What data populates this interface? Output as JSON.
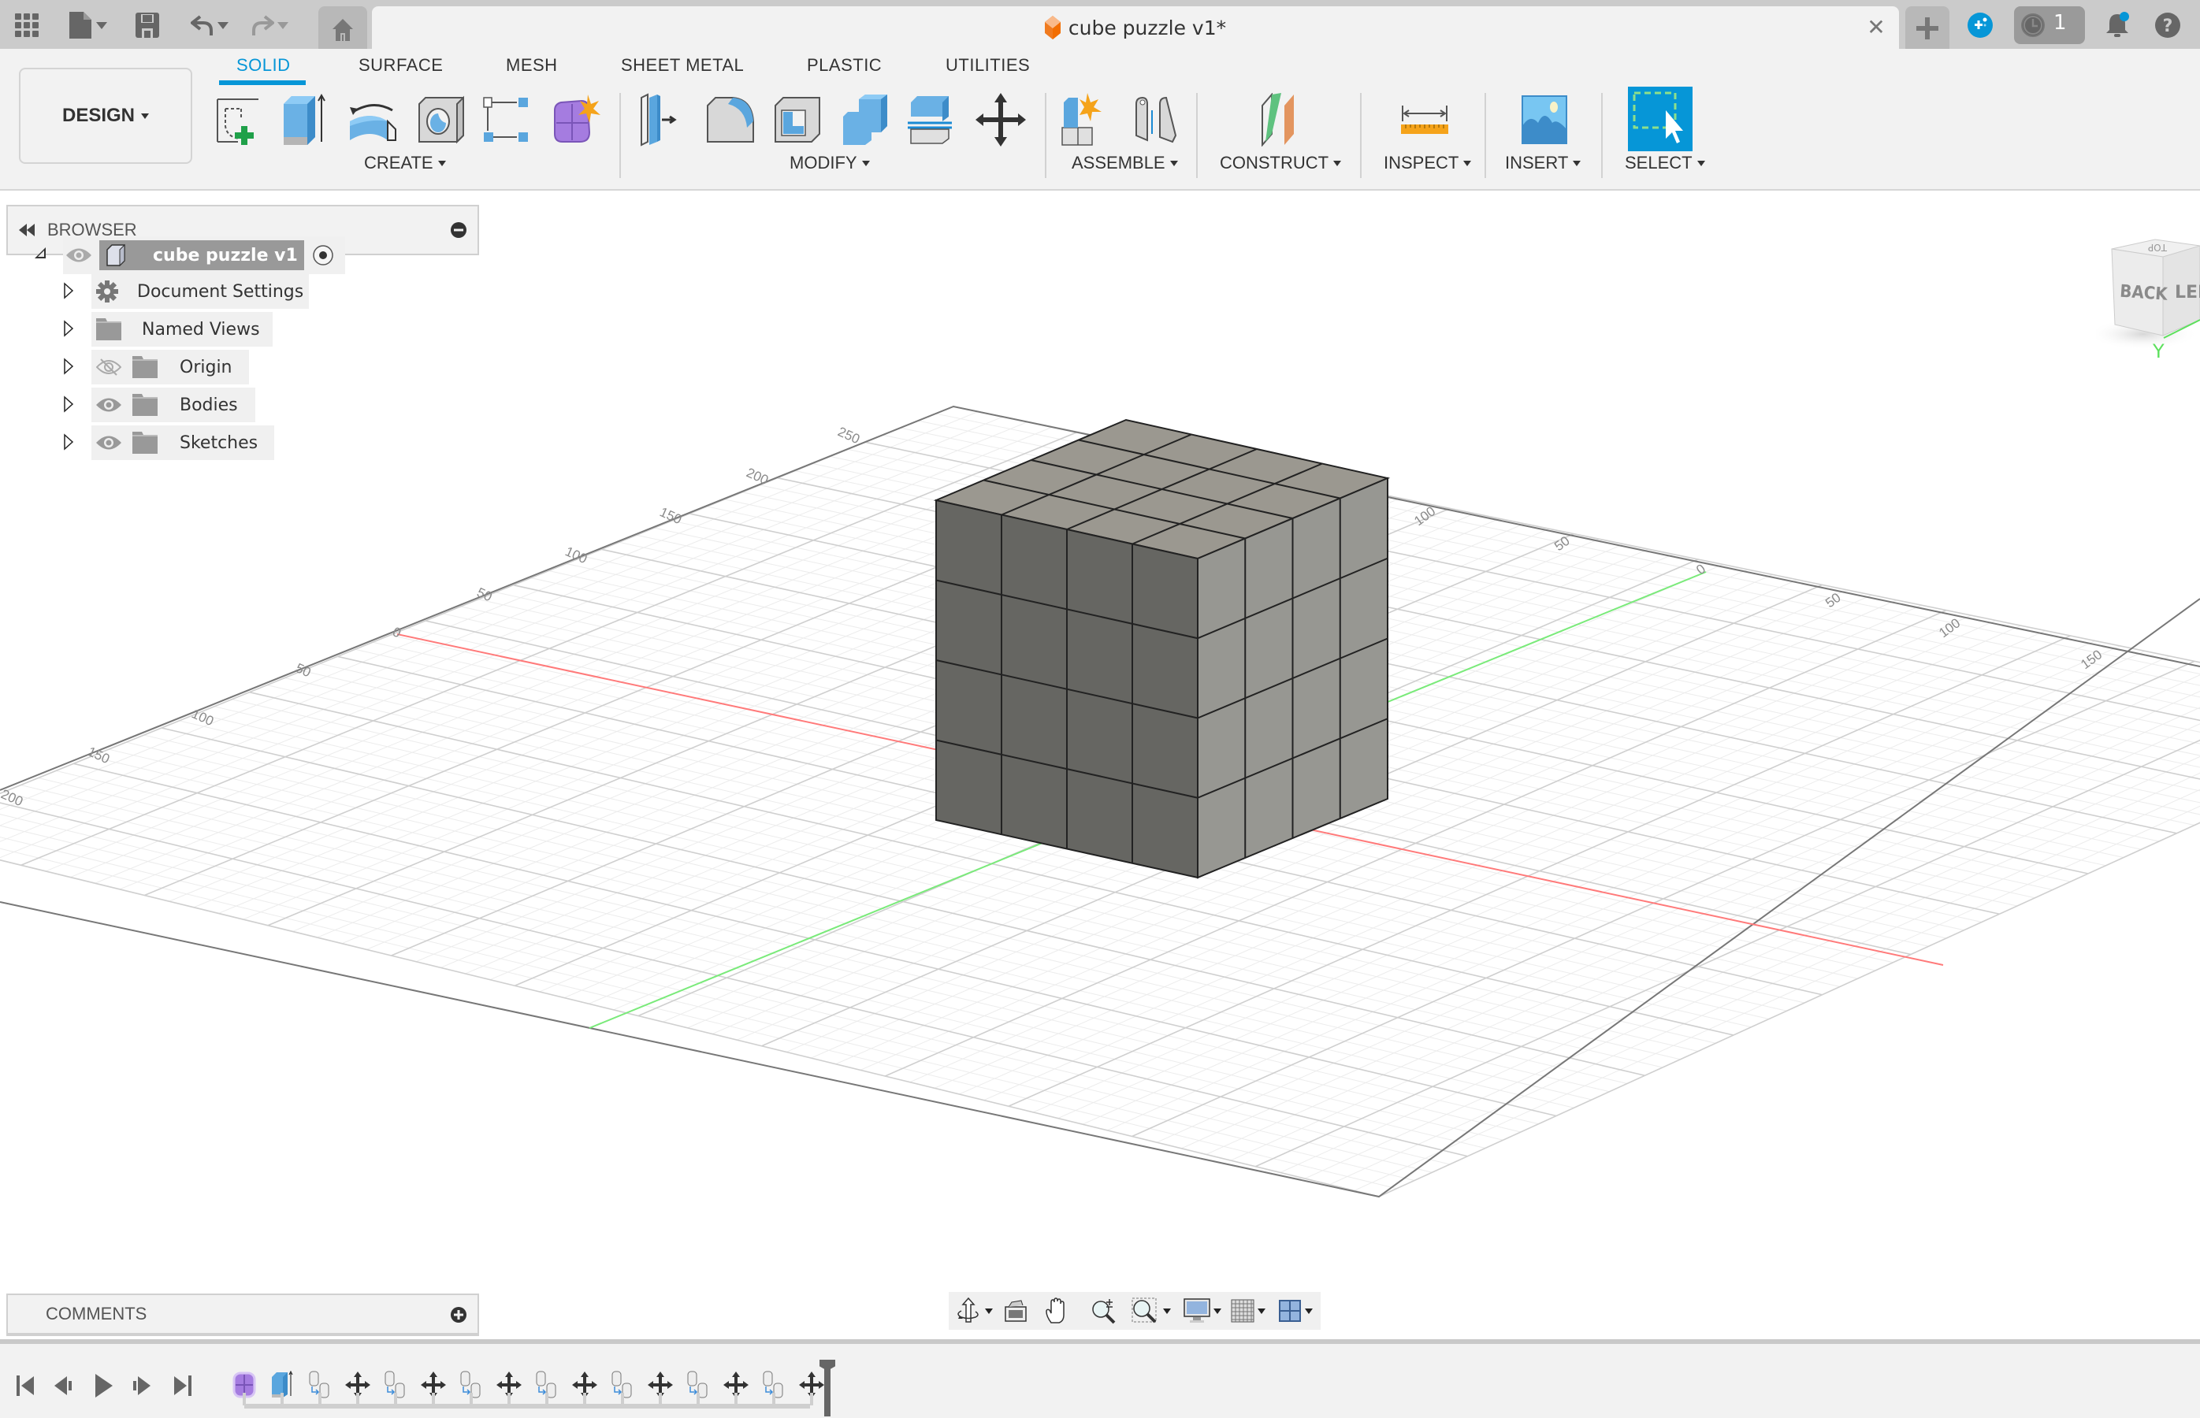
{
  "app": {
    "document_title": "cube puzzle v1*",
    "jobs_count": "1",
    "icons": {
      "apps_grid": "grid-icon",
      "file": "file-icon",
      "save": "save-icon",
      "undo": "undo-icon",
      "redo": "redo-icon",
      "home": "home-icon",
      "close_tab": "close-icon",
      "new_tab": "plus-icon",
      "extensions": "extensions-icon",
      "jobs": "clock-icon",
      "notifications": "bell-icon",
      "help": "help-icon"
    }
  },
  "toolbar": {
    "workspace_label": "DESIGN",
    "tabs": [
      {
        "label": "SOLID",
        "active": true
      },
      {
        "label": "SURFACE",
        "active": false
      },
      {
        "label": "MESH",
        "active": false
      },
      {
        "label": "SHEET METAL",
        "active": false
      },
      {
        "label": "PLASTIC",
        "active": false
      },
      {
        "label": "UTILITIES",
        "active": false
      }
    ],
    "groups": [
      {
        "label": "CREATE",
        "tools": [
          "create-sketch",
          "extrude",
          "revolve",
          "hole",
          "pattern",
          "create-form"
        ]
      },
      {
        "label": "MODIFY",
        "tools": [
          "press-pull",
          "fillet",
          "shell",
          "combine",
          "split-body",
          "move-copy"
        ]
      },
      {
        "label": "ASSEMBLE",
        "tools": [
          "new-component",
          "joint"
        ]
      },
      {
        "label": "CONSTRUCT",
        "tools": [
          "offset-plane"
        ]
      },
      {
        "label": "INSPECT",
        "tools": [
          "measure"
        ]
      },
      {
        "label": "INSERT",
        "tools": [
          "insert-image"
        ]
      },
      {
        "label": "SELECT",
        "tools": [
          "window-select"
        ]
      }
    ]
  },
  "browser": {
    "title": "BROWSER",
    "root": {
      "label": "cube puzzle v1"
    },
    "items": [
      {
        "label": "Document Settings",
        "icon": "gear-icon",
        "visibility": "none"
      },
      {
        "label": "Named Views",
        "icon": "folder-icon",
        "visibility": "none"
      },
      {
        "label": "Origin",
        "icon": "folder-icon",
        "visibility": "hidden"
      },
      {
        "label": "Bodies",
        "icon": "folder-icon",
        "visibility": "visible"
      },
      {
        "label": "Sketches",
        "icon": "folder-icon",
        "visibility": "visible"
      }
    ]
  },
  "comments": {
    "title": "COMMENTS"
  },
  "viewcube": {
    "faces": [
      "BACK",
      "LEFT",
      "TOP"
    ],
    "axis_label": "Y"
  },
  "grid": {
    "left_axis_labels": [
      "250",
      "200",
      "150",
      "100",
      "50",
      "0",
      "50",
      "100",
      "150",
      "200"
    ],
    "right_axis_labels": [
      "100",
      "50",
      "0",
      "50",
      "100",
      "150"
    ]
  },
  "model": {
    "name": "cube puzzle",
    "divisions": 4
  },
  "navbar": {
    "tools": [
      "orbit",
      "look-at",
      "pan",
      "zoom",
      "fit-window",
      "display-settings",
      "grid-settings",
      "viewports"
    ]
  },
  "timeline": {
    "controls": [
      "go-to-start",
      "previous-step",
      "play",
      "next-step",
      "go-to-end"
    ],
    "features": [
      "form",
      "extrude",
      "copy-body",
      "move",
      "copy-body",
      "move",
      "copy-body",
      "move",
      "copy-body",
      "move",
      "copy-body",
      "move",
      "copy-body",
      "move",
      "copy-body",
      "move"
    ]
  }
}
